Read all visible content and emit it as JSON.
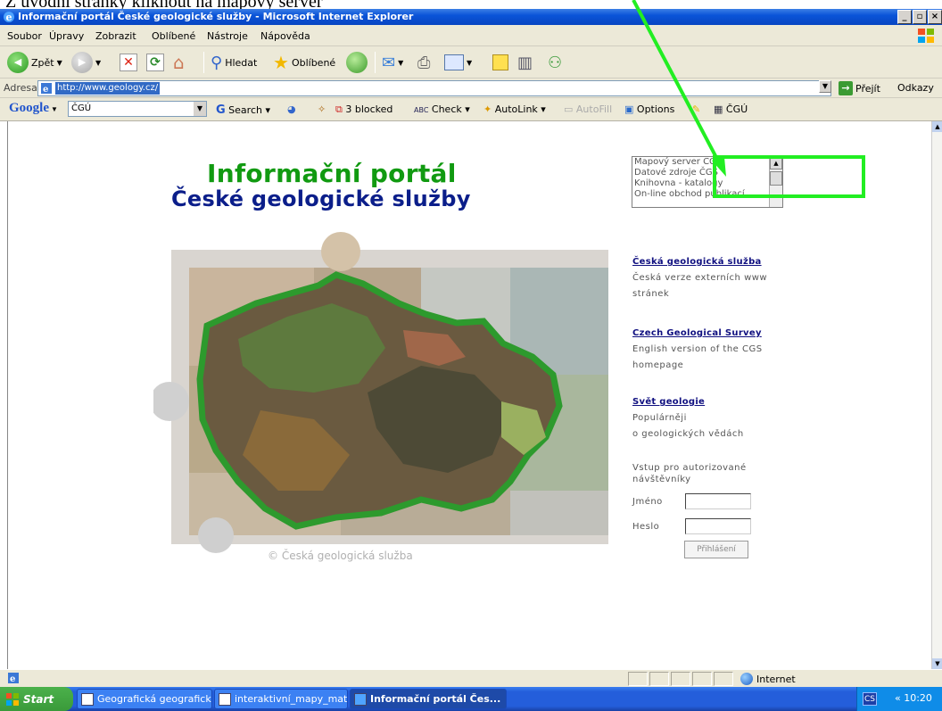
{
  "caption": "Z úvodní stránky kliknout na mapový server",
  "window": {
    "title": "Informační portál České geologické služby - Microsoft Internet Explorer"
  },
  "menu": [
    "Soubor",
    "Úpravy",
    "Zobrazit",
    "Oblíbené",
    "Nástroje",
    "Nápověda"
  ],
  "toolbar": {
    "back_label": "Zpět",
    "search_label": "Hledat",
    "favorites_label": "Oblíbené"
  },
  "address": {
    "label": "Adresa",
    "url": "http://www.geology.cz/",
    "go_label": "Přejít",
    "links_label": "Odkazy"
  },
  "google": {
    "logo": "Google",
    "query": "ČGÚ",
    "search_label": "Search",
    "blocked_label": "3 blocked",
    "check_label": "Check",
    "autolink_label": "AutoLink",
    "autofill_label": "AutoFill",
    "options_label": "Options",
    "cgu_label": "ČGÚ"
  },
  "page": {
    "title_line1": "Informační portál",
    "title_line2": "České geologické služby",
    "listbox_options": [
      "Mapový server ČGS",
      "Datové zdroje ČGS",
      "Knihovna - katalogy",
      "On-line obchod publikací"
    ],
    "copyright": "© Česká geologická služba",
    "links": [
      {
        "title": "Česká geologická služba",
        "line1": "Česká verze externích www",
        "line2": "stránek"
      },
      {
        "title": "Czech Geological Survey",
        "line1": "English version of the CGS",
        "line2": "homepage"
      },
      {
        "title": "Svět geologie",
        "line1": "Populárněji",
        "line2": "o geologických vědách"
      }
    ],
    "login": {
      "heading_line1": "Vstup pro autorizované",
      "heading_line2": "návštěvníky",
      "name_label": "Jméno",
      "password_label": "Heslo",
      "submit_label": "Přihlášení"
    }
  },
  "status": {
    "zone": "Internet"
  },
  "taskbar": {
    "start": "Start",
    "tasks": [
      "Geografická geografická ...",
      "interaktivní_mapy_mater...",
      "Informační portál Čes..."
    ],
    "lang": "CS",
    "time": "« 10:20"
  },
  "colors": {
    "title_green": "#119a11",
    "title_blue": "#0b1e8a",
    "highlight_green": "#22ee22",
    "link_blue": "#101080"
  }
}
